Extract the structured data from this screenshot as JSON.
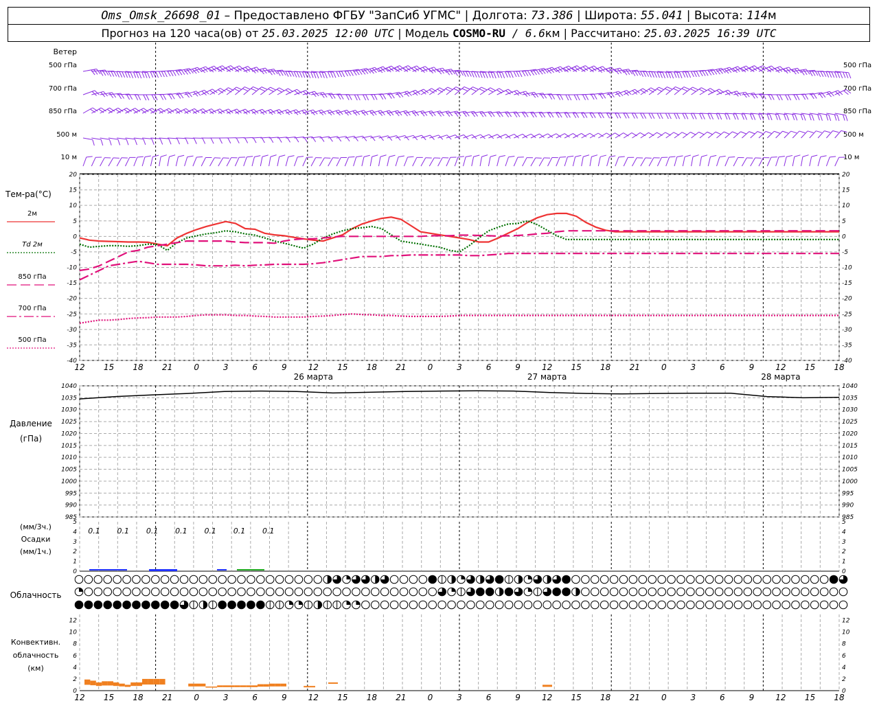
{
  "header": {
    "station": "Oms_Omsk_26698_01",
    "sep1": " – Предоставлено ФГБУ \"ЗапСиб УГМС\" | Долгота: ",
    "lon": "73.386",
    "sep2": " | Широта: ",
    "lat": "55.041",
    "sep3": " | Высота: ",
    "alt": "114",
    "alt_unit": "м",
    "line2_a": "Прогноз на 120 часа(ов) от ",
    "issue": "25.03.2025 12:00 UTC",
    "line2_b": " | Модель ",
    "model": "COSMO-RU",
    "line2_c": " / 6.6",
    "res_unit": "км",
    "line2_d": " | Рассчитано: ",
    "computed": "25.03.2025 16:39 UTC"
  },
  "wind_panel": {
    "title": "Ветер",
    "levels": [
      "500 гПа",
      "700 гПа",
      "850 гПа",
      "500 м",
      "10 м"
    ],
    "color": "#8a2be2"
  },
  "temp_panel": {
    "title": "Тем-ра(°С)",
    "legend": [
      {
        "label": "2м",
        "color": "#ee3333",
        "style": "solid"
      },
      {
        "label": "Td  2м",
        "color": "#007000",
        "style": "dotted"
      },
      {
        "label": "850 гПа",
        "color": "#e0107a",
        "style": "dash"
      },
      {
        "label": "700 гПа",
        "color": "#e0107a",
        "style": "dashdot"
      },
      {
        "label": "500 гПа",
        "color": "#e0107a",
        "style": "dotted"
      }
    ],
    "yticks": [
      20,
      15,
      10,
      5,
      0,
      -5,
      -10,
      -15,
      -20,
      -25,
      -30,
      -35,
      -40
    ]
  },
  "time_axis": {
    "hours": [
      "12",
      "15",
      "18",
      "21",
      "0",
      "3",
      "6",
      "9",
      "12",
      "15",
      "18",
      "21",
      "0",
      "3",
      "6",
      "9",
      "12",
      "15",
      "18",
      "21",
      "0",
      "3",
      "6",
      "9",
      "12",
      "15",
      "18"
    ],
    "dates": [
      "26 марта",
      "27 марта",
      "28 марта"
    ]
  },
  "pressure_panel": {
    "title": "Давление",
    "unit": "(гПа)",
    "yticks": [
      1040,
      1035,
      1030,
      1025,
      1020,
      1015,
      1010,
      1005,
      1000,
      995,
      990,
      985
    ]
  },
  "precip_panel": {
    "unit_top": "(мм/3ч.)",
    "title": "Осадки",
    "unit_bottom": "(мм/1ч.)",
    "yticks": [
      5,
      4,
      3,
      2,
      1,
      0
    ],
    "amount_labels": [
      "0.1",
      "0.1",
      "0.1",
      "0.1",
      "0.1",
      "0.1",
      "0.1"
    ]
  },
  "cloud_panel": {
    "title": "Облачность"
  },
  "conv_panel": {
    "title_1": "Конвективн.",
    "title_2": "облачность",
    "unit": "(км)",
    "yticks": [
      12,
      10,
      8,
      6,
      4,
      2,
      0
    ]
  },
  "chart_data": [
    {
      "type": "line",
      "title": "Тем-ра(°С)",
      "x_hours_from_start": [
        0,
        3,
        6,
        9,
        12,
        15,
        18,
        21,
        24,
        27,
        30,
        33,
        36,
        39,
        42,
        45,
        48,
        51,
        54,
        57,
        60,
        63,
        66,
        69,
        72,
        75,
        78,
        81,
        84,
        87,
        90,
        93,
        96,
        99,
        102,
        105,
        108,
        111,
        114,
        117,
        120,
        123,
        126,
        129,
        132,
        135,
        138,
        141,
        144,
        147,
        150,
        153,
        156,
        159,
        162,
        165,
        168,
        171,
        174,
        177,
        180,
        183,
        186,
        189,
        192,
        195,
        198,
        201,
        204,
        207,
        210,
        213,
        216,
        219,
        222,
        225,
        228,
        231,
        234
      ],
      "ylim": [
        -40,
        20
      ],
      "series": [
        {
          "name": "2м",
          "values": [
            -0.5,
            -1.2,
            -1.5,
            -1.6,
            -1.7,
            -1.8,
            -1.8,
            -1.9,
            -2.5,
            -3,
            -0.5,
            1,
            2.2,
            3.2,
            4,
            4.8,
            4.2,
            2.5,
            2.3,
            1,
            0.5,
            0.2,
            -0.3,
            -0.8,
            -1.2,
            -1.5,
            -0.5,
            0.5,
            2.5,
            4,
            5,
            5.8,
            6.2,
            5.5,
            3.5,
            1.5,
            1,
            0.5,
            0,
            -0.5,
            -1,
            -1.8,
            -1.8,
            -0.5,
            1,
            2.5,
            4.5,
            6,
            7,
            7.4,
            7.4,
            6.5,
            4.5,
            3,
            2,
            1.5,
            1.5,
            1.5,
            1.5,
            1.5,
            1.5,
            1.5,
            1.5,
            1.5,
            1.5,
            1.5,
            1.5,
            1.5,
            1.5,
            1.5,
            1.5,
            1.5,
            1.5,
            1.5,
            1.5,
            1.5,
            1.5,
            1.5,
            1.5
          ]
        },
        {
          "name": "Td  2м",
          "values": [
            -2.5,
            -3.5,
            -3.2,
            -3.0,
            -3.0,
            -3.2,
            -3.0,
            -2.5,
            -2.6,
            -4.5,
            -2,
            -0.5,
            0.2,
            0.8,
            1.2,
            1.8,
            1.5,
            0.8,
            0.4,
            -0.5,
            -1.5,
            -2.2,
            -3,
            -3.8,
            -2.5,
            -0.5,
            0.8,
            1.8,
            2.5,
            2.8,
            3.2,
            2.5,
            0.5,
            -1.5,
            -2,
            -2.5,
            -3,
            -3.5,
            -4.5,
            -5,
            -3,
            -0.5,
            1.8,
            3,
            4,
            4.2,
            5,
            3.8,
            2,
            0.2,
            -1,
            -1,
            -1,
            -1,
            -1,
            -1,
            -1,
            -1,
            -1,
            -1,
            -1,
            -1,
            -1,
            -1,
            -1,
            -1,
            -1,
            -1,
            -1,
            -1,
            -1,
            -1,
            -1,
            -1,
            -1,
            -1,
            -1,
            -1,
            -1
          ]
        },
        {
          "name": "850 гПа",
          "values": [
            -11,
            -10.5,
            -9.5,
            -8,
            -6.5,
            -5,
            -4.5,
            -3.5,
            -3,
            -2.5,
            -2,
            -1.5,
            -1.5,
            -1.5,
            -1.5,
            -1.5,
            -1.8,
            -2,
            -2,
            -2,
            -2.2,
            -1.5,
            -1,
            -0.8,
            -0.8,
            -0.5,
            -0.2,
            0,
            0,
            0,
            0,
            0,
            0,
            0,
            0,
            0,
            0.2,
            0.2,
            0.2,
            0.4,
            0.4,
            0.3,
            0.2,
            0.1,
            0.2,
            0.3,
            0.5,
            0.8,
            1,
            1.5,
            1.8,
            1.8,
            1.8,
            1.8,
            1.8,
            1.8,
            1.8,
            1.8,
            1.8,
            1.8,
            1.8,
            1.8,
            1.8,
            1.8,
            1.8,
            1.8,
            1.8,
            1.8,
            1.8,
            1.8,
            1.8,
            1.8,
            1.8,
            1.8,
            1.8,
            1.8,
            1.8,
            1.8,
            1.8
          ]
        },
        {
          "name": "700 гПа",
          "values": [
            -14,
            -12.5,
            -11,
            -9.5,
            -9,
            -8.5,
            -8,
            -8.5,
            -9,
            -9,
            -9,
            -9,
            -9.2,
            -9.5,
            -9.5,
            -9.5,
            -9.3,
            -9.5,
            -9.3,
            -9.2,
            -9,
            -9,
            -9,
            -9,
            -8.8,
            -8.5,
            -8,
            -7.5,
            -7,
            -6.5,
            -6.5,
            -6.5,
            -6.2,
            -6.2,
            -6,
            -6,
            -6,
            -6,
            -6,
            -6,
            -6.2,
            -6.2,
            -6,
            -5.8,
            -5.5,
            -5.5,
            -5.5,
            -5.5,
            -5.5,
            -5.5,
            -5.5,
            -5.5,
            -5.5,
            -5.5,
            -5.5,
            -5.5,
            -5.5,
            -5.5,
            -5.5,
            -5.5,
            -5.5,
            -5.5,
            -5.5,
            -5.5,
            -5.5,
            -5.5,
            -5.5,
            -5.5,
            -5.5,
            -5.5,
            -5.5,
            -5.5,
            -5.5,
            -5.5,
            -5.5,
            -5.5,
            -5.5,
            -5.5,
            -5.5
          ]
        },
        {
          "name": "500 гПа",
          "values": [
            -28,
            -27.5,
            -27,
            -27,
            -26.8,
            -26.5,
            -26.3,
            -26.2,
            -26,
            -26,
            -26,
            -25.8,
            -25.5,
            -25.3,
            -25.3,
            -25.3,
            -25.5,
            -25.5,
            -25.7,
            -25.8,
            -26,
            -26,
            -26,
            -26,
            -25.8,
            -25.7,
            -25.5,
            -25.2,
            -25,
            -25.2,
            -25.3,
            -25.5,
            -25.5,
            -25.7,
            -25.8,
            -25.8,
            -25.8,
            -25.8,
            -25.7,
            -25.5,
            -25.5,
            -25.5,
            -25.5,
            -25.5,
            -25.5,
            -25.5,
            -25.5,
            -25.5,
            -25.5,
            -25.5,
            -25.5,
            -25.5,
            -25.5,
            -25.5,
            -25.5,
            -25.5,
            -25.5,
            -25.5,
            -25.5,
            -25.5,
            -25.5,
            -25.5,
            -25.5,
            -25.5,
            -25.5,
            -25.5,
            -25.5,
            -25.5,
            -25.5,
            -25.5,
            -25.5,
            -25.5,
            -25.5,
            -25.5,
            -25.5,
            -25.5,
            -25.5,
            -25.5,
            -25.5
          ]
        }
      ]
    },
    {
      "type": "line",
      "title": "Давление",
      "x_hours_from_start": [
        0,
        6,
        12,
        18,
        24,
        30,
        36,
        42,
        48,
        54,
        60,
        66,
        72,
        78,
        84,
        90,
        96,
        102,
        108,
        114,
        120,
        126
      ],
      "ylim": [
        985,
        1040
      ],
      "series": [
        {
          "name": "",
          "values": [
            1034.5,
            1035.5,
            1036.2,
            1036.8,
            1037.6,
            1037.8,
            1037.6,
            1037.0,
            1037.3,
            1037.6,
            1037.8,
            1037.9,
            1037.8,
            1037.2,
            1036.8,
            1036.6,
            1036.8,
            1036.9,
            1036.9,
            1035.5,
            1035.0,
            1035.2
          ]
        }
      ]
    },
    {
      "type": "bar",
      "title": "Осадки",
      "x_hours_from_start": [
        0,
        3,
        6,
        9,
        12,
        15,
        18,
        21,
        24,
        27,
        30,
        33,
        36
      ],
      "ylim": [
        0,
        5
      ],
      "series": [
        {
          "name": "",
          "values": [
            0.05,
            0.05,
            0.05,
            0.05,
            0.1,
            0.1,
            0,
            0.05,
            0.05,
            0.05,
            0.05,
            0,
            0
          ]
        }
      ]
    },
    {
      "type": "bar",
      "title": "Конвективн. облачность",
      "x_hours_from_start": [
        0,
        1,
        2,
        3,
        4,
        5,
        6,
        7,
        8,
        9,
        10,
        11,
        12,
        13,
        14,
        15,
        16,
        17,
        18,
        19,
        20,
        21,
        22,
        23,
        24,
        25,
        26,
        27,
        28,
        29,
        30,
        31,
        32,
        33,
        34,
        35,
        36,
        37,
        38,
        39,
        40,
        41,
        42,
        43,
        44,
        45,
        46,
        47,
        48,
        49,
        50,
        51,
        52,
        53,
        54,
        55,
        56,
        57,
        58,
        59,
        60
      ],
      "ylim": [
        0,
        13
      ],
      "series": [
        {
          "name": "",
          "values": [
            1.5,
            1.3,
            1.0,
            1.2,
            1.2,
            1.0,
            0.8,
            0.6,
            1.0,
            1.0,
            1.6,
            1.6,
            1.6,
            1.6,
            0,
            0,
            0,
            0,
            0.8,
            0.8,
            0.8,
            0.3,
            0.3,
            0.5,
            0.5,
            0.5,
            0.5,
            0.5,
            0.5,
            0.5,
            0.7,
            0.7,
            0.8,
            0.8,
            0.8,
            0,
            0,
            0,
            0.4,
            0.4,
            0,
            0,
            0,
            0,
            0,
            0,
            0,
            0,
            0,
            0,
            0,
            0,
            0,
            0,
            0,
            0,
            0,
            0,
            0,
            0,
            0
          ]
        }
      ]
    }
  ]
}
